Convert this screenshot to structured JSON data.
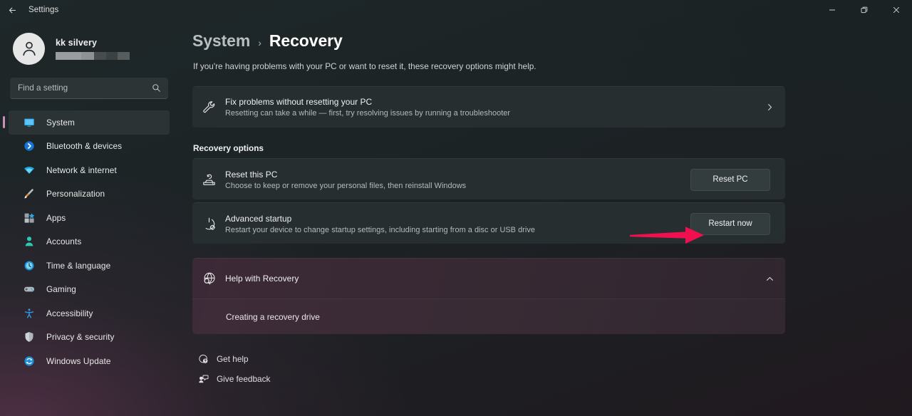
{
  "titlebar": {
    "back_icon": "arrow-left-icon",
    "app_title": "Settings",
    "minimize_label": "Minimize",
    "restore_label": "Restore",
    "close_label": "Close"
  },
  "sidebar": {
    "profile": {
      "name": "kk silvery",
      "account_redacted": true
    },
    "search": {
      "placeholder": "Find a setting",
      "value": "",
      "icon": "search-icon"
    },
    "items": [
      {
        "label": "System",
        "icon": "display-icon",
        "active": true
      },
      {
        "label": "Bluetooth & devices",
        "icon": "bluetooth-icon",
        "active": false
      },
      {
        "label": "Network & internet",
        "icon": "wifi-icon",
        "active": false
      },
      {
        "label": "Personalization",
        "icon": "paintbrush-icon",
        "active": false
      },
      {
        "label": "Apps",
        "icon": "apps-icon",
        "active": false
      },
      {
        "label": "Accounts",
        "icon": "account-icon",
        "active": false
      },
      {
        "label": "Time & language",
        "icon": "clock-icon",
        "active": false
      },
      {
        "label": "Gaming",
        "icon": "gamepad-icon",
        "active": false
      },
      {
        "label": "Accessibility",
        "icon": "accessibility-icon",
        "active": false
      },
      {
        "label": "Privacy & security",
        "icon": "shield-icon",
        "active": false
      },
      {
        "label": "Windows Update",
        "icon": "update-icon",
        "active": false
      }
    ]
  },
  "main": {
    "breadcrumb": {
      "parent": "System",
      "separator": "›",
      "current": "Recovery"
    },
    "page_description": "If you're having problems with your PC or want to reset it, these recovery options might help.",
    "fix_problems": {
      "icon": "wrench-icon",
      "title": "Fix problems without resetting your PC",
      "subtitle": "Resetting can take a while — first, try resolving issues by running a troubleshooter",
      "chevron": "chevron-right-icon"
    },
    "recovery_options_heading": "Recovery options",
    "options": [
      {
        "icon": "reset-pc-icon",
        "title": "Reset this PC",
        "subtitle": "Choose to keep or remove your personal files, then reinstall Windows",
        "button": "Reset PC"
      },
      {
        "icon": "advanced-startup-icon",
        "title": "Advanced startup",
        "subtitle": "Restart your device to change startup settings, including starting from a disc or USB drive",
        "button": "Restart now"
      }
    ],
    "help": {
      "icon": "globe-search-icon",
      "title": "Help with Recovery",
      "chevron": "chevron-up-icon",
      "links": [
        "Creating a recovery drive"
      ]
    },
    "footer": [
      {
        "icon": "get-help-icon",
        "label": "Get help"
      },
      {
        "icon": "feedback-icon",
        "label": "Give feedback"
      }
    ]
  },
  "annotation": {
    "type": "arrow",
    "color": "#F0104F",
    "points_to": "Restart now"
  },
  "colors": {
    "accent_bar": "#c98fb4",
    "arrow": "#F0104F",
    "card_bg": "#262e2f",
    "window_bg": "#1e2729"
  }
}
